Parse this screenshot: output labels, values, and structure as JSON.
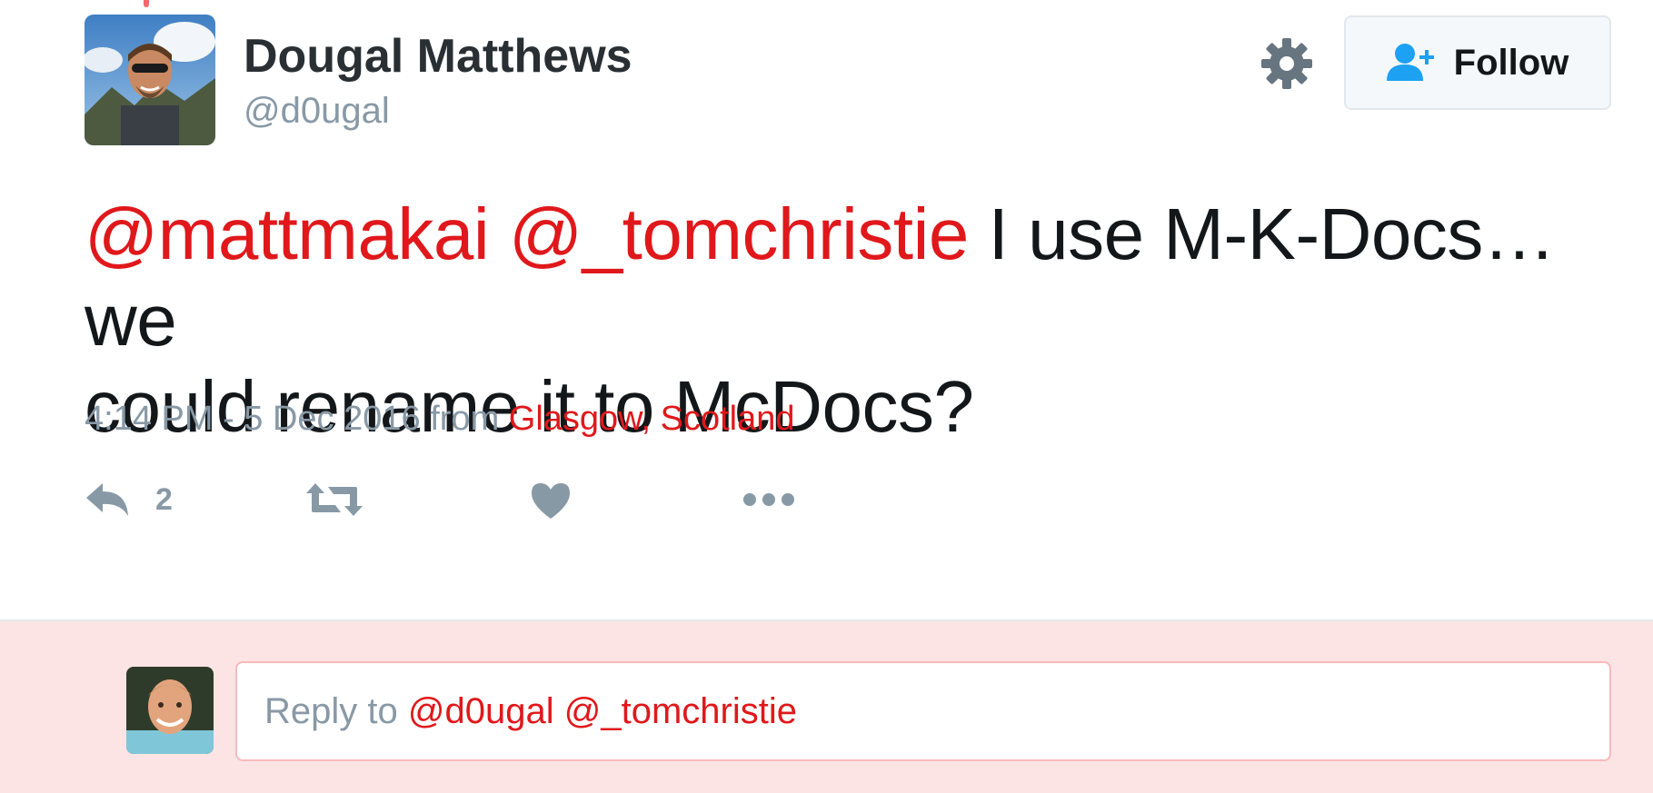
{
  "author": {
    "name": "Dougal Matthews",
    "handle": "@d0ugal"
  },
  "header": {
    "follow_label": "Follow",
    "settings_icon": "gear-icon",
    "follow_icon": "add-user-icon"
  },
  "tweet": {
    "mention_1": "@mattmakai",
    "mention_2": "@_tomchristie",
    "body_line_1": "I use M-K-Docs… we",
    "body_line_2": "could rename it to McDocs?",
    "timestamp": "4:14 PM - 5 Dec 2016",
    "from_word": "from",
    "location": "Glasgow, Scotland"
  },
  "actions": {
    "reply_count": "2",
    "reply_icon": "reply-icon",
    "retweet_icon": "retweet-icon",
    "like_icon": "heart-icon",
    "more_icon": "more-dots-icon"
  },
  "reply": {
    "prefix": "Reply to",
    "mention_1": "@d0ugal",
    "mention_2": "@_tomchristie"
  },
  "colors": {
    "accent": "#e0181b",
    "muted": "#8899a6",
    "reply_background": "#fce4e5"
  }
}
